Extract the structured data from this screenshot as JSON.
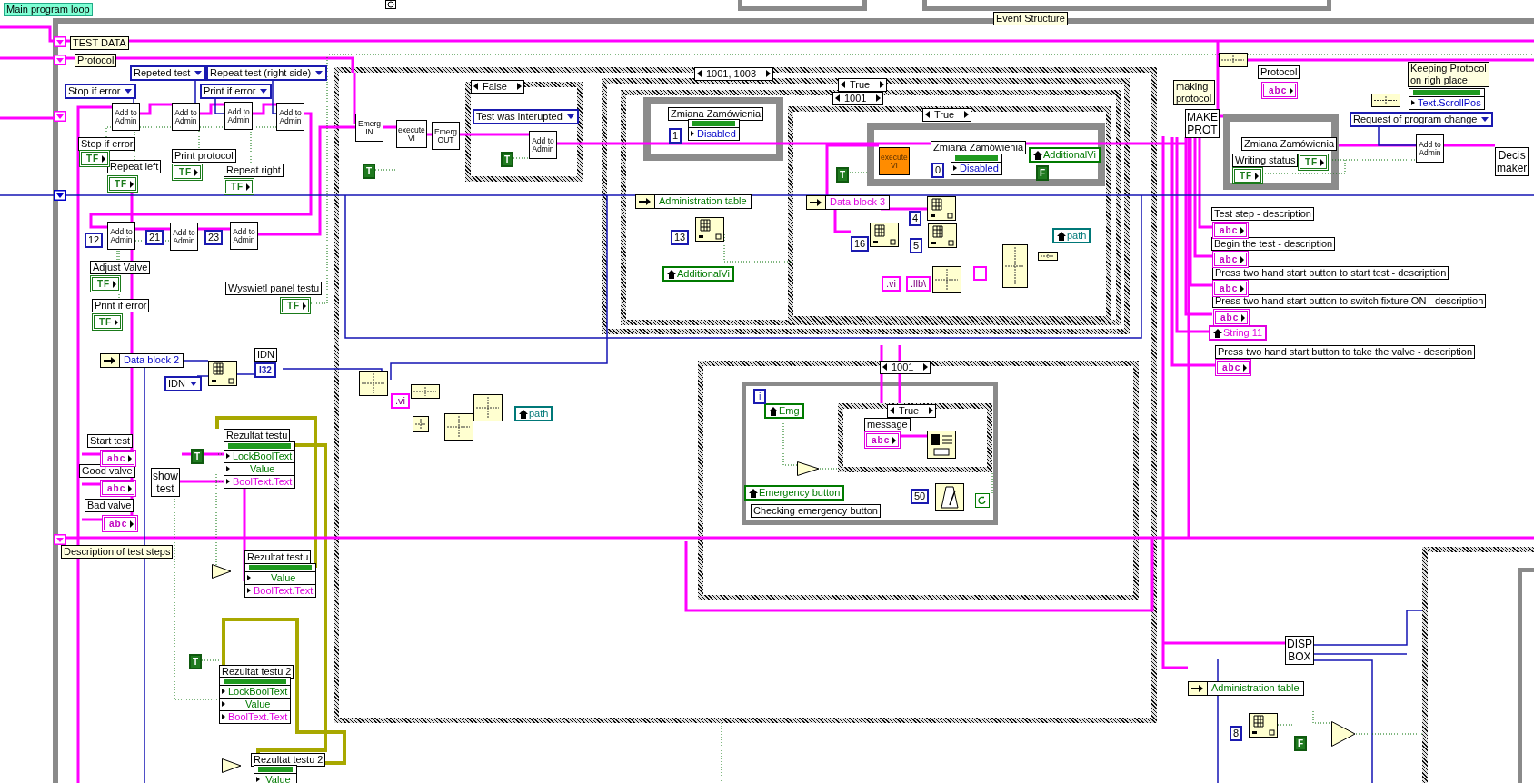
{
  "diagram_label": "Main program loop",
  "structure_label": "Event Structure",
  "shift_registers": [
    {
      "label": "TEST DATA"
    },
    {
      "label": "Protocol"
    },
    {
      "label": "Description of test steps"
    }
  ],
  "rings": [
    "Stop if error",
    "Repeted test",
    "Repeat test (right side)",
    "Print if error",
    "IDN",
    "Test was interupted",
    "Request of program change"
  ],
  "subvis": [
    {
      "text": "Add to Admin",
      "kind": "small"
    },
    {
      "text": "Add to Admin",
      "kind": "small"
    },
    {
      "text": "Add to Admin",
      "kind": "small"
    },
    {
      "text": "Add to Admin",
      "kind": "small"
    },
    {
      "text": "Add to Admin",
      "kind": "small"
    },
    {
      "text": "Add to Admin",
      "kind": "small"
    },
    {
      "text": "Add to Admin",
      "kind": "small"
    },
    {
      "text": "Emerg IN",
      "kind": "small"
    },
    {
      "text": "execute VI",
      "kind": "small"
    },
    {
      "text": "Emerg OUT",
      "kind": "small"
    },
    {
      "text": "Add to Admin",
      "kind": "small"
    },
    {
      "text": "MAKE PROT",
      "kind": "large"
    },
    {
      "text": "Add to Admin",
      "kind": "small"
    },
    {
      "text": "Decis maker",
      "kind": "large"
    },
    {
      "text": "show test",
      "kind": "large"
    },
    {
      "text": "DISP BOX",
      "kind": "large"
    }
  ],
  "highlighted_node": {
    "text": "execute VI"
  },
  "labels": [
    "Stop if error",
    "Repeat left",
    "Print protocol",
    "Repeat right",
    "Adjust Valve",
    "Print if error",
    "Wyswietl panel testu",
    "IDN",
    "Start test",
    "Good valve",
    "Bad valve",
    "Rezultat testu",
    "Rezultat testu",
    "Rezultat testu 2",
    "Rezultat testu 2",
    "Zmiana Zamówienia",
    "Zmiana Zamówienia",
    "message",
    "Checking emergency button",
    "Protocol",
    "Zmiana Zamówienia",
    "Writing status",
    "Test step - description",
    "Begin the test - description",
    "Press two hand start button to start test - description",
    "Press two hand start button to switch fixture ON - description",
    "Press two hand start button to take the valve - description"
  ],
  "notes": [
    "making protocol",
    "Keeping Protocol on righ place"
  ],
  "terminals": [
    {
      "text": "TF",
      "kind": "boolean"
    },
    {
      "text": "TF",
      "kind": "boolean"
    },
    {
      "text": "TF",
      "kind": "boolean"
    },
    {
      "text": "TF",
      "kind": "boolean"
    },
    {
      "text": "TF",
      "kind": "boolean"
    },
    {
      "text": "TF",
      "kind": "boolean"
    },
    {
      "text": "TF",
      "kind": "boolean"
    },
    {
      "text": "abc",
      "kind": "string"
    },
    {
      "text": "abc",
      "kind": "string"
    },
    {
      "text": "abc",
      "kind": "string"
    },
    {
      "text": "abc",
      "kind": "string"
    },
    {
      "text": "abc",
      "kind": "string"
    },
    {
      "text": "TF",
      "kind": "boolean"
    },
    {
      "text": "TF",
      "kind": "boolean"
    },
    {
      "text": "abc",
      "kind": "string"
    },
    {
      "text": "abc",
      "kind": "string"
    },
    {
      "text": "abc",
      "kind": "string"
    },
    {
      "text": "abc",
      "kind": "string"
    },
    {
      "text": "abc",
      "kind": "string"
    }
  ],
  "numeric_constants": [
    "12",
    "21",
    "23",
    "13",
    "1",
    "16",
    "4",
    "5",
    "0",
    "50",
    "8"
  ],
  "boolean_constants": [
    "T",
    "T",
    "T",
    "F",
    "T",
    "T",
    "F"
  ],
  "case_selectors": [
    "1001, 1003",
    "False",
    "True",
    "1001",
    "True",
    "1001",
    "True"
  ],
  "property_nodes": [
    {
      "rows": [
        {
          "text": "Disabled",
          "color": "#0000c8"
        }
      ]
    },
    {
      "rows": [
        {
          "text": "Disabled",
          "color": "#0000c8"
        }
      ]
    },
    {
      "rows": [
        {
          "text": "Text.ScrollPos",
          "color": "#0000c8"
        }
      ]
    },
    {
      "rows": [
        {
          "text": "LockBoolText",
          "color": "#007a00"
        },
        {
          "text": "Value",
          "color": "#007a00"
        },
        {
          "text": "BoolText.Text",
          "color": "#e000e0"
        }
      ]
    },
    {
      "rows": [
        {
          "text": "Value",
          "color": "#007a00"
        },
        {
          "text": "BoolText.Text",
          "color": "#e000e0"
        }
      ]
    },
    {
      "rows": [
        {
          "text": "LockBoolText",
          "color": "#007a00"
        },
        {
          "text": "Value",
          "color": "#007a00"
        },
        {
          "text": "BoolText.Text",
          "color": "#e000e0"
        }
      ]
    },
    {
      "rows": [
        {
          "text": "Value",
          "color": "#007a00"
        }
      ]
    }
  ],
  "local_variables": [
    {
      "text": "AdditionalVi",
      "color": "#007a00"
    },
    {
      "text": "AdditionalVi",
      "color": "#007a00"
    },
    {
      "text": "path",
      "color": "#007878"
    },
    {
      "text": "path",
      "color": "#007878"
    },
    {
      "text": "Emg",
      "color": "#007a00"
    },
    {
      "text": "Emergency button",
      "color": "#007a00"
    },
    {
      "text": "String 11",
      "color": "#e000e0"
    }
  ],
  "unbundle_nodes": [
    {
      "text": "Data block 2",
      "color": "#0000c8"
    },
    {
      "text": "Administration table",
      "color": "#007a00"
    },
    {
      "text": "Data block 3",
      "color": "#e000e0"
    },
    {
      "text": "Administration table",
      "color": "#007a00"
    }
  ],
  "string_constants": [
    ".vi",
    ".llb\\",
    ".vi"
  ],
  "indicator": {
    "text": "I32"
  },
  "iteration_terminal": {
    "text": "i"
  }
}
